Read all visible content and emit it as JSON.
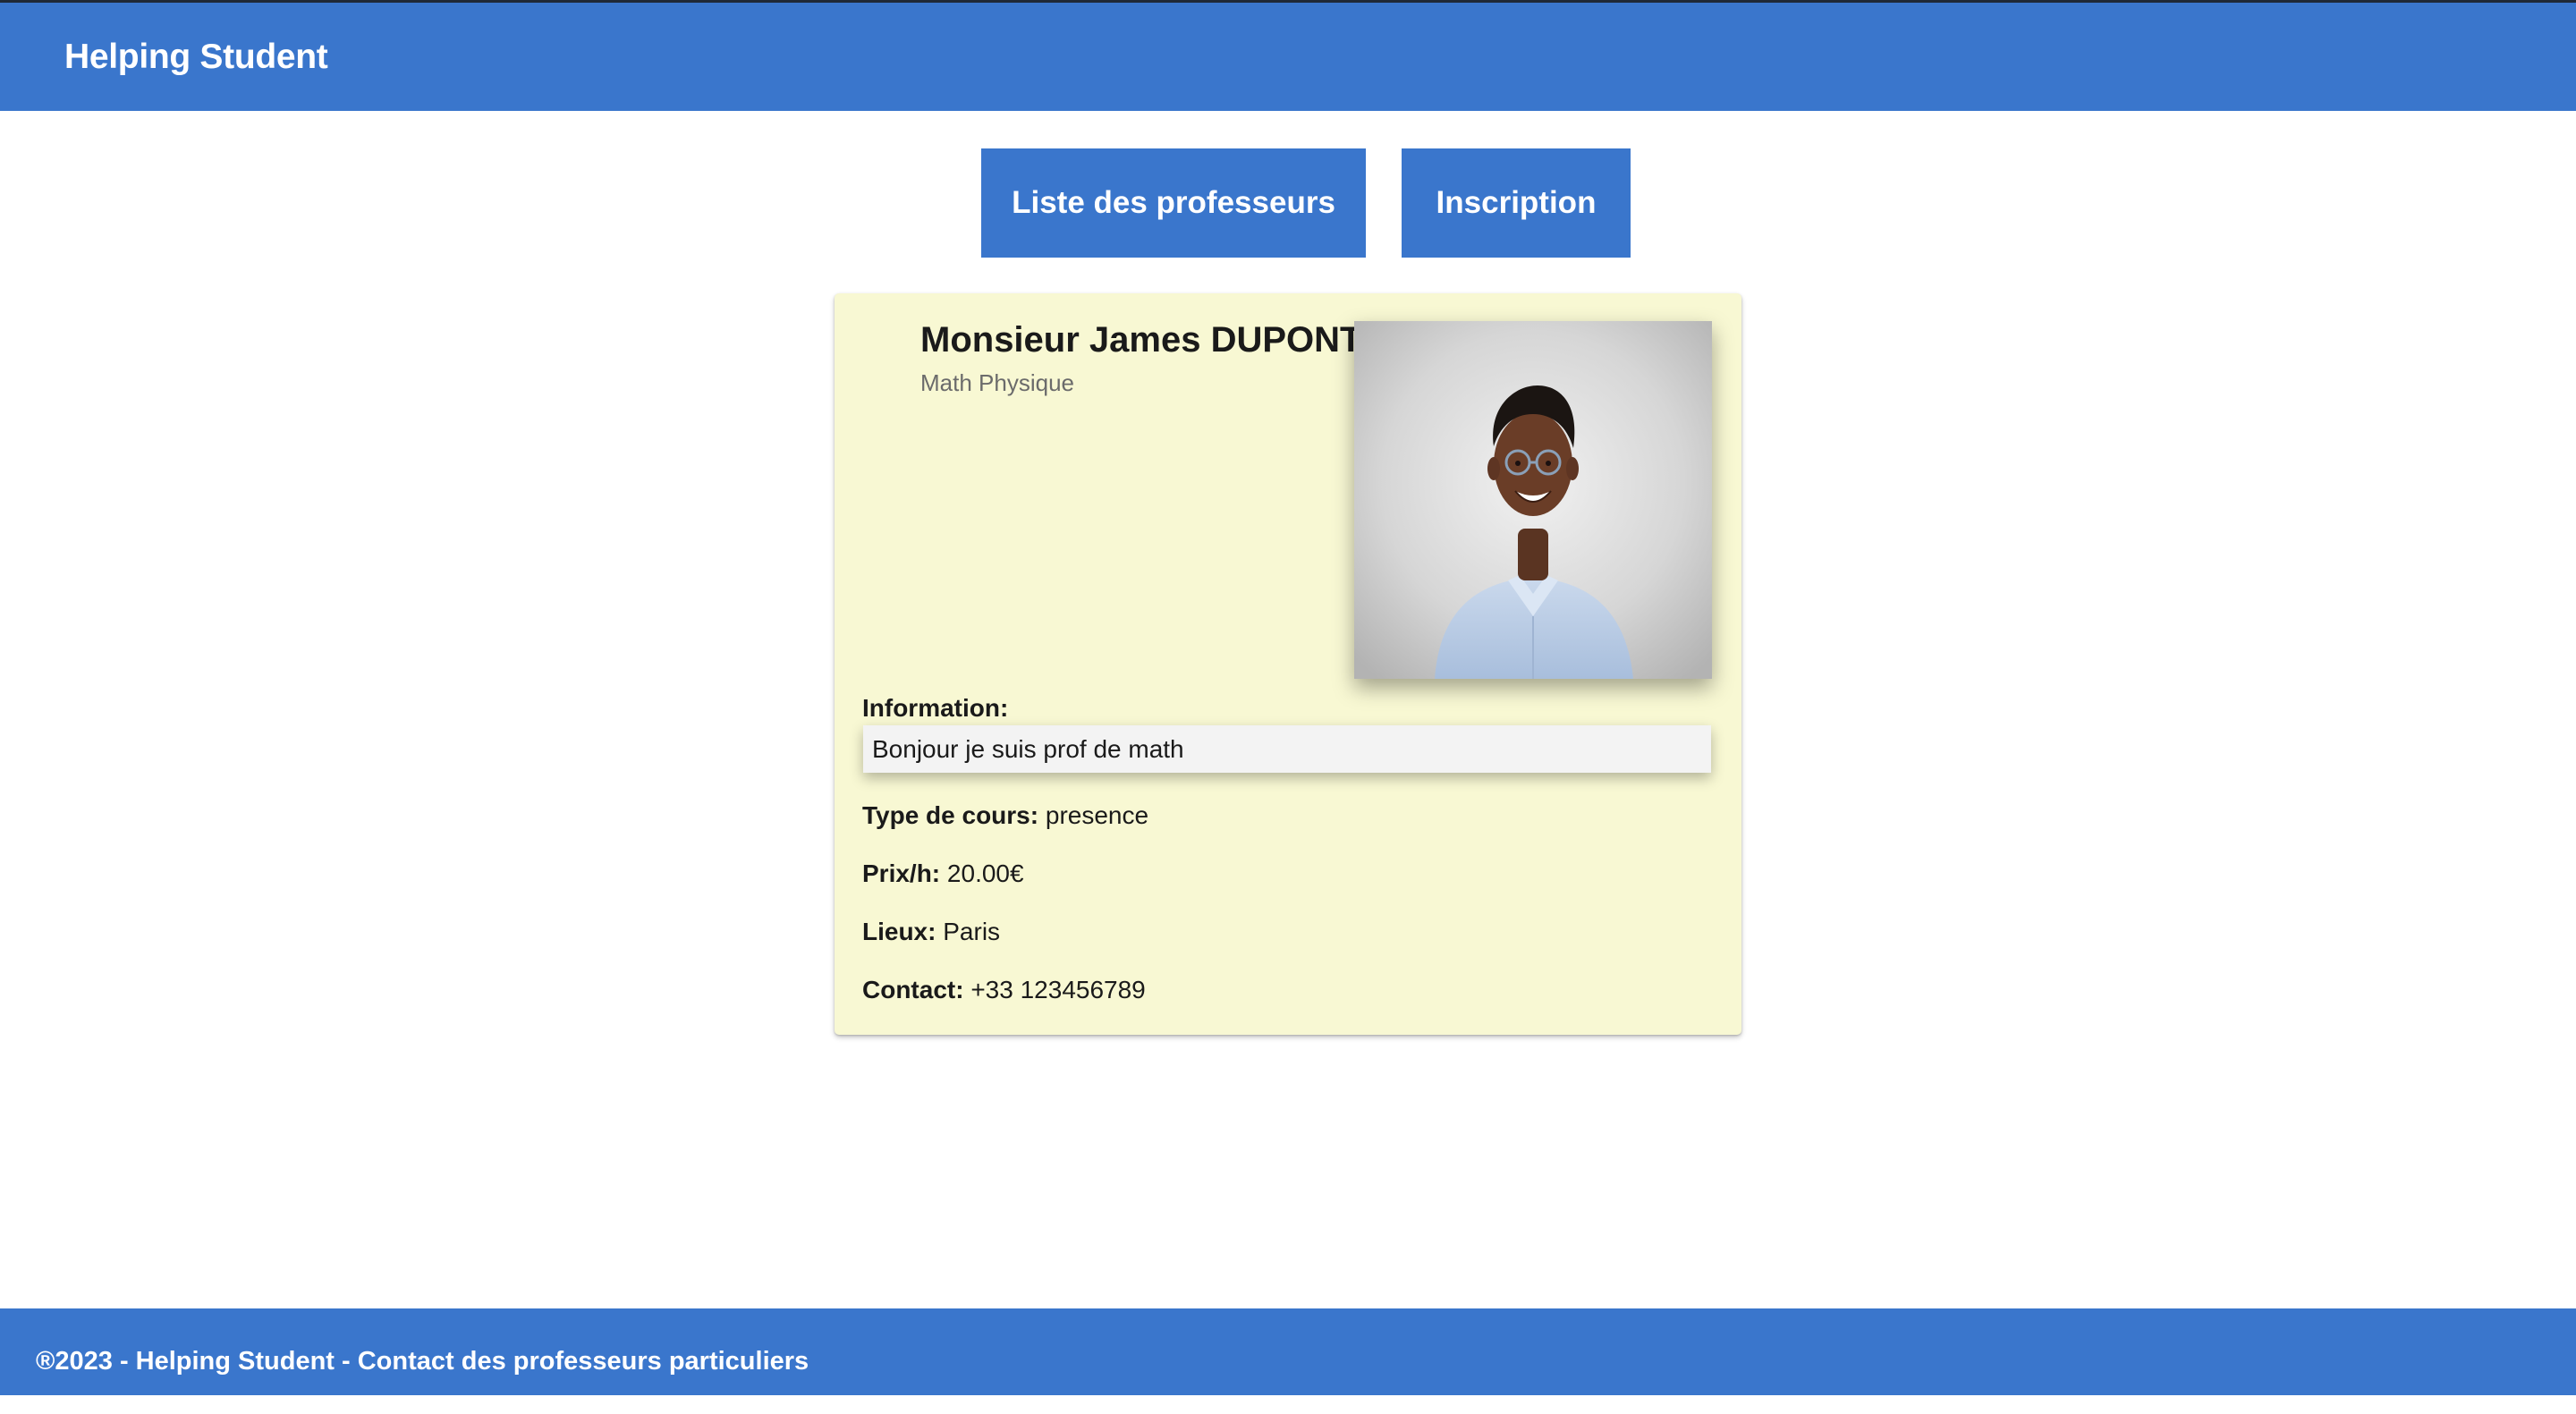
{
  "app": {
    "title": "Helping Student",
    "brand_color": "#3a76cc"
  },
  "nav": {
    "teachers_label": "Liste des professeurs",
    "signup_label": "Inscription"
  },
  "teacher": {
    "name": "Monsieur James DUPONT",
    "subjects": "Math Physique",
    "photo_alt": "portrait-photo",
    "information_label": "Information:",
    "information_value": "Bonjour je suis prof de math",
    "course_type_label": "Type de cours:",
    "course_type_value": "presence",
    "price_label": "Prix/h:",
    "price_value": "20.00€",
    "location_label": "Lieux:",
    "location_value": "Paris",
    "contact_label": "Contact:",
    "contact_value": "+33 123456789",
    "card_color": "#f8f8d3"
  },
  "footer": {
    "text": "®2023 - Helping Student - Contact des professeurs particuliers"
  }
}
